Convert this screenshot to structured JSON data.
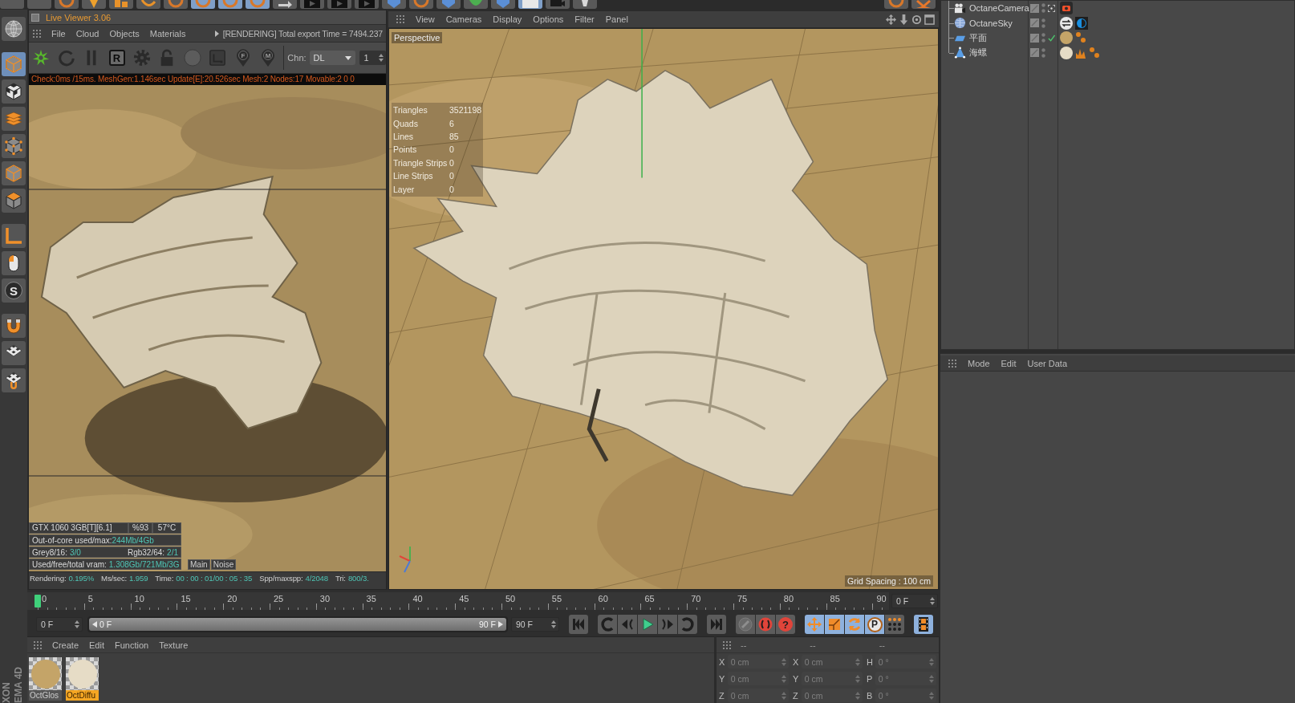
{
  "top_toolbar": {
    "left": [
      {
        "kind": "blank",
        "selected": false
      },
      {
        "kind": "blank",
        "selected": false
      },
      {
        "kind": "ring",
        "selected": false
      },
      {
        "kind": "pin",
        "selected": false
      },
      {
        "kind": "blocks",
        "selected": false
      },
      {
        "kind": "bend",
        "selected": false
      },
      {
        "kind": "ring",
        "selected": false
      },
      {
        "kind": "ring",
        "selected": true
      },
      {
        "kind": "ring",
        "selected": true
      },
      {
        "kind": "ring",
        "selected": true
      },
      {
        "kind": "arrow",
        "selected": false
      },
      {
        "kind": "clapper",
        "selected": false
      },
      {
        "kind": "clapper",
        "selected": false
      },
      {
        "kind": "clapper",
        "selected": false
      },
      {
        "kind": "cube",
        "selected": false
      },
      {
        "kind": "ring",
        "selected": false
      },
      {
        "kind": "cube",
        "selected": false
      },
      {
        "kind": "leaf",
        "selected": false
      },
      {
        "kind": "cube",
        "selected": false
      },
      {
        "kind": "grid",
        "selected": true
      },
      {
        "kind": "camera",
        "selected": false
      },
      {
        "kind": "lamp",
        "selected": false
      }
    ],
    "right": [
      {
        "kind": "ring",
        "selected": false
      },
      {
        "kind": "cross",
        "selected": false
      }
    ]
  },
  "left_toolbar": [
    {
      "kind": "globe",
      "selected": false
    },
    {
      "kind": "cube",
      "selected": true
    },
    {
      "kind": "checker-cube",
      "selected": false
    },
    {
      "kind": "layers",
      "selected": false
    },
    {
      "kind": "points",
      "selected": false
    },
    {
      "kind": "edges",
      "selected": false
    },
    {
      "kind": "polygons",
      "selected": false
    },
    {
      "kind": "axis",
      "selected": false
    },
    {
      "kind": "mouse",
      "selected": false
    },
    {
      "kind": "letter",
      "label": "S",
      "selected": false
    },
    {
      "kind": "magnet",
      "selected": false
    },
    {
      "kind": "checker",
      "selected": false
    },
    {
      "kind": "checker-magnet",
      "selected": false
    }
  ],
  "brand_text": [
    "XON",
    "EMA 4D"
  ],
  "live_viewer": {
    "title": "Live Viewer 3.06",
    "menu": [
      "File",
      "Cloud",
      "Objects",
      "Materials"
    ],
    "status": "[RENDERING] Total export Time = 7494.237",
    "toolbar": [
      {
        "kind": "octane-logo"
      },
      {
        "kind": "refresh"
      },
      {
        "kind": "pause"
      },
      {
        "kind": "letter",
        "label": "R"
      },
      {
        "kind": "gear"
      },
      {
        "kind": "lock"
      },
      {
        "kind": "disc"
      },
      {
        "kind": "region"
      },
      {
        "kind": "pin",
        "label": "F"
      },
      {
        "kind": "pin",
        "label": "M"
      }
    ],
    "channel": {
      "label": "Chn:",
      "value": "DL"
    },
    "spinner": "1",
    "info": "Check:0ms /15ms. MeshGen:1.146sec Update[E]:20.526sec Mesh:2 Nodes:17 Movable:2  0 0",
    "overlay": {
      "gpu": [
        "GTX 1060 3GB[T][6.1]",
        "%93",
        "57°C"
      ],
      "lines": [
        [
          {
            "label": "Out-of-core used/max:",
            "value": "244Mb/4Gb"
          }
        ],
        [
          {
            "label": "Grey8/16:",
            "value": "3/0"
          },
          {
            "label": "Rgb32/64:",
            "value": "2/1"
          }
        ],
        [
          {
            "label": "Used/free/total vram:",
            "value": "1.308Gb/721Mb/3G"
          }
        ]
      ],
      "buttons": [
        "Main",
        "Noise"
      ]
    },
    "render_stats": [
      {
        "label": "Rendering:",
        "value": "0.195%"
      },
      {
        "label": "Ms/sec:",
        "value": "1.959"
      },
      {
        "label": "Time:",
        "value": "00 : 00 : 01/00 : 05 : 35"
      },
      {
        "label": "Spp/maxspp:",
        "value": "4/2048"
      },
      {
        "label": "Tri:",
        "value": "800/3."
      }
    ]
  },
  "viewport": {
    "menu": [
      "View",
      "Cameras",
      "Display",
      "Options",
      "Filter",
      "Panel"
    ],
    "camera": "Perspective",
    "stats": [
      {
        "label": "Triangles",
        "value": "3521198"
      },
      {
        "label": "Quads",
        "value": "6"
      },
      {
        "label": "Lines",
        "value": "85"
      },
      {
        "label": "Points",
        "value": "0"
      },
      {
        "label": "Triangle Strips",
        "value": "0"
      },
      {
        "label": "Line Strips",
        "value": "0"
      },
      {
        "label": "Layer",
        "value": "0"
      }
    ],
    "grid_spacing": "Grid Spacing : 100 cm"
  },
  "timeline": {
    "ticks": [
      "0",
      "5",
      "10",
      "15",
      "20",
      "25",
      "30",
      "35",
      "40",
      "45",
      "50",
      "55",
      "60",
      "65",
      "70",
      "75",
      "80",
      "85",
      "90"
    ],
    "playhead": {
      "level": 0
    },
    "frame": "0 F"
  },
  "transport": {
    "start": "0 F",
    "range": {
      "from": "0 F",
      "to": "90 F",
      "level": 1
    },
    "end": "90 F",
    "groups": [
      [
        {
          "kind": "first",
          "on": false
        }
      ],
      [
        {
          "kind": "prev-key",
          "on": false
        },
        {
          "kind": "prev-frame",
          "on": false
        },
        {
          "kind": "play",
          "on": false
        },
        {
          "kind": "next-frame",
          "on": false
        },
        {
          "kind": "next-key",
          "on": false
        }
      ],
      [
        {
          "kind": "last",
          "on": false
        }
      ],
      [
        {
          "kind": "key",
          "on": false
        },
        {
          "kind": "record",
          "on": false
        },
        {
          "kind": "help",
          "label": "?",
          "on": false
        }
      ],
      [
        {
          "kind": "move",
          "on": true
        },
        {
          "kind": "scale",
          "on": true
        },
        {
          "kind": "rotate",
          "on": true
        },
        {
          "kind": "letter",
          "label": "P",
          "on": true
        },
        {
          "kind": "dots",
          "on": false
        }
      ],
      [
        {
          "kind": "film",
          "on": true
        }
      ]
    ]
  },
  "materials": {
    "menu": [
      "Create",
      "Edit",
      "Function",
      "Texture"
    ],
    "items": [
      {
        "name": "OctGlos",
        "color": "#c4a468",
        "selected": false
      },
      {
        "name": "OctDiffu",
        "color": "#e6dcc6",
        "selected": true
      }
    ]
  },
  "coordinates": {
    "headers": [
      "--",
      "--",
      "--"
    ],
    "disabled": true,
    "rows": [
      [
        {
          "label": "X",
          "value": "0 cm"
        },
        {
          "label": "X",
          "value": "0 cm"
        },
        {
          "label": "H",
          "value": "0 °"
        }
      ],
      [
        {
          "label": "Y",
          "value": "0 cm"
        },
        {
          "label": "Y",
          "value": "0 cm"
        },
        {
          "label": "P",
          "value": "0 °"
        }
      ],
      [
        {
          "label": "Z",
          "value": "0 cm"
        },
        {
          "label": "Z",
          "value": "0 cm"
        },
        {
          "label": "B",
          "value": "0 °"
        }
      ]
    ]
  },
  "objects": {
    "rows": [
      {
        "name": "OctaneCamera",
        "kind": "camera",
        "flags": [
          {
            "kind": "target"
          }
        ],
        "tags": [
          {
            "kind": "camera-tag"
          }
        ]
      },
      {
        "name": "OctaneSky",
        "kind": "sky",
        "tags": [
          {
            "kind": "swap-tag"
          },
          {
            "kind": "half-tag"
          }
        ]
      },
      {
        "name": "平面",
        "kind": "plane",
        "flags": [
          {
            "kind": "check"
          }
        ],
        "tags": [
          {
            "kind": "material",
            "color": "#c4a468"
          },
          {
            "kind": "dots-tag"
          }
        ]
      },
      {
        "name": "海螺",
        "kind": "polygon",
        "tags": [
          {
            "kind": "material",
            "color": "#e6dcc6"
          },
          {
            "kind": "phong-tag"
          },
          {
            "kind": "dots-tag"
          }
        ]
      }
    ]
  },
  "attributes": {
    "menu": [
      "Mode",
      "Edit",
      "User Data"
    ]
  }
}
